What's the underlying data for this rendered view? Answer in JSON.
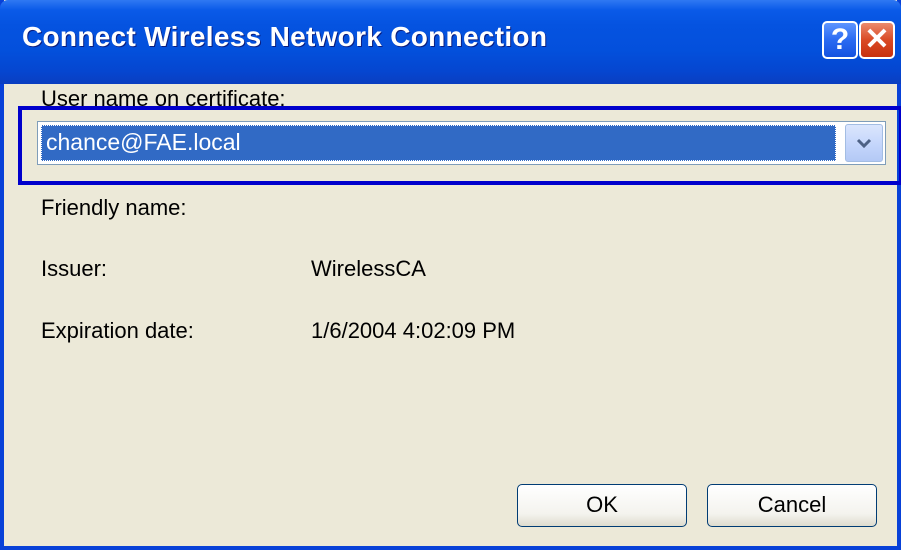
{
  "window": {
    "title": "Connect Wireless Network Connection",
    "help_label": "?",
    "close_label": "✕"
  },
  "form": {
    "username_label": "User name on certificate:",
    "username_value": "chance@FAE.local",
    "friendly_name_label": "Friendly name:",
    "friendly_name_value": "",
    "issuer_label": "Issuer:",
    "issuer_value": "WirelessCA",
    "expiration_label": "Expiration date:",
    "expiration_value": "1/6/2004 4:02:09 PM"
  },
  "buttons": {
    "ok_label": "OK",
    "cancel_label": "Cancel"
  },
  "colors": {
    "titlebar": "#0350dc",
    "highlight_frame": "#0000cc",
    "selection": "#316ac5",
    "dialog_bg": "#ece9d8"
  },
  "icons": {
    "help": "help-icon",
    "close": "close-icon",
    "dropdown": "chevron-down-icon"
  }
}
